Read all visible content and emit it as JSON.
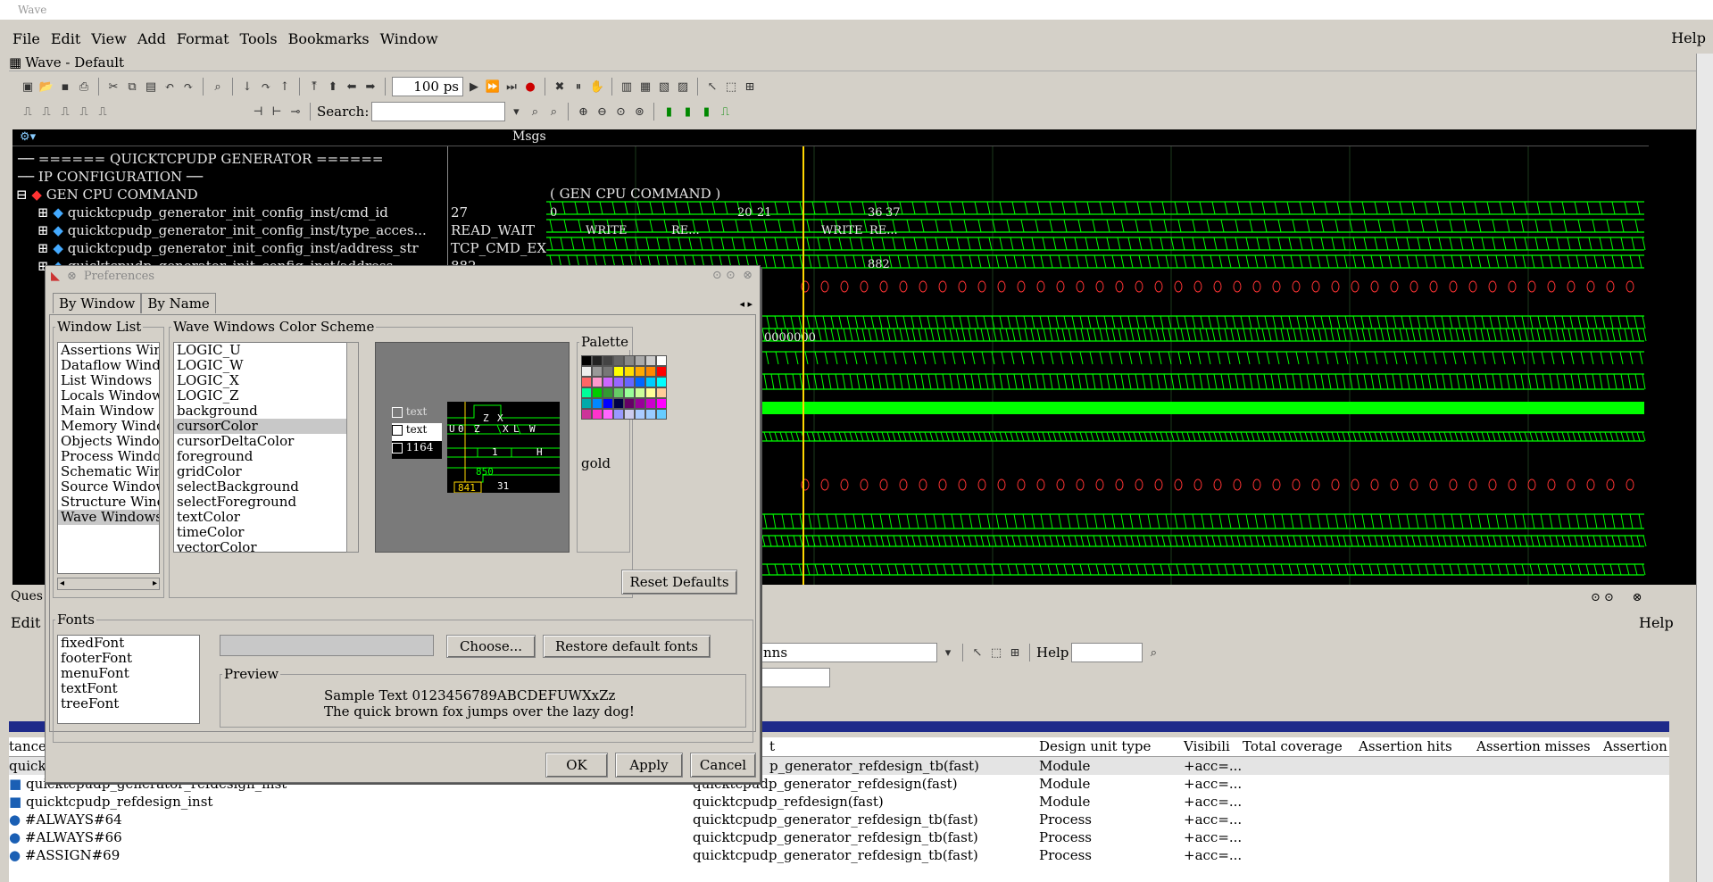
{
  "window": {
    "title": "Wave",
    "subtitle": "Wave - Default",
    "help": "Help"
  },
  "menus": [
    "File",
    "Edit",
    "View",
    "Add",
    "Format",
    "Tools",
    "Bookmarks",
    "Window"
  ],
  "toolbar": {
    "zoom_value": "100 ps",
    "search_label": "Search:"
  },
  "wave": {
    "msgs_label": "Msgs",
    "rows": [
      {
        "name": "====== QUICKTCPUDP GENERATOR ======",
        "value": ""
      },
      {
        "name": "IP CONFIGURATION",
        "value": ""
      },
      {
        "name": "GEN CPU COMMAND",
        "value": ""
      },
      {
        "name": "quicktcpudp_generator_init_config_inst/cmd_id",
        "value": "27"
      },
      {
        "name": "quicktcpudp_generator_init_config_inst/type_acces...",
        "value": "READ_WAIT"
      },
      {
        "name": "quicktcpudp_generator_init_config_inst/address_str",
        "value": "TCP_CMD_EX..."
      },
      {
        "name": "quicktcpudp_generator_init_config_inst/address",
        "value": "882"
      }
    ],
    "group_label": "( GEN CPU COMMAND )",
    "bus_values": [
      "0",
      "20",
      "21",
      "36",
      "37",
      "WRITE",
      "RE...",
      "WRITE",
      "RE...",
      "882",
      "0000000"
    ]
  },
  "prefs": {
    "title": "Preferences",
    "tabs": [
      "By Window",
      "By Name"
    ],
    "window_list_label": "Window List",
    "window_list": [
      "Assertions Windo",
      "Dataflow Windows",
      "List Windows",
      "Locals Window",
      "Main Window",
      "Memory Windows",
      "Objects Window",
      "Process Window",
      "Schematic Window",
      "Source Windows",
      "Structure Window",
      "Wave Windows"
    ],
    "scheme_label": "Wave Windows Color Scheme",
    "scheme_items": [
      "LOGIC_U",
      "LOGIC_W",
      "LOGIC_X",
      "LOGIC_Z",
      "background",
      "cursorColor",
      "cursorDeltaColor",
      "foreground",
      "gridColor",
      "selectBackground",
      "selectForeground",
      "textColor",
      "timeColor",
      "vectorColor"
    ],
    "preview_labels": [
      "text",
      "text",
      "1164"
    ],
    "preview_nums": [
      "850",
      "841",
      "31"
    ],
    "preview_letters": [
      "U",
      "0",
      "Z",
      "X",
      "L",
      "H",
      "1",
      "Z",
      "X",
      "W"
    ],
    "palette_label": "Palette",
    "palette_selected": "gold",
    "reset_defaults": "Reset Defaults",
    "fonts_label": "Fonts",
    "fonts": [
      "fixedFont",
      "footerFont",
      "menuFont",
      "textFont",
      "treeFont"
    ],
    "choose": "Choose...",
    "restore_fonts": "Restore default fonts",
    "preview_label": "Preview",
    "preview_line1": "Sample Text 0123456789ABCDEFUWXxZz",
    "preview_line2": "The quick brown fox jumps over the lazy dog!",
    "ok": "OK",
    "apply": "Apply",
    "cancel": "Cancel"
  },
  "lower": {
    "edit": "Edit",
    "help": "Help",
    "help_field": "Help",
    "ques": "Ques",
    "ns_text": "nns",
    "headers": [
      "Design unit type",
      "Visibili",
      "Total coverage",
      "Assertion hits",
      "Assertion misses",
      "Assertion"
    ],
    "left_hdr": "tance",
    "col2_hdr": "t",
    "rows": [
      {
        "inst": "quick",
        "design": "p_generator_refdesign_tb(fast)",
        "type": "Module",
        "vis": "+acc=..."
      },
      {
        "inst": "quicktcpudp_generator_refdesign_inst",
        "design": "quicktcpudp_generator_refdesign(fast)",
        "type": "Module",
        "vis": "+acc=..."
      },
      {
        "inst": "quicktcpudp_refdesign_inst",
        "design": "quicktcpudp_refdesign(fast)",
        "type": "Module",
        "vis": "+acc=..."
      },
      {
        "inst": "#ALWAYS#64",
        "design": "quicktcpudp_generator_refdesign_tb(fast)",
        "type": "Process",
        "vis": "+acc=..."
      },
      {
        "inst": "#ALWAYS#66",
        "design": "quicktcpudp_generator_refdesign_tb(fast)",
        "type": "Process",
        "vis": "+acc=..."
      },
      {
        "inst": "#ASSIGN#69",
        "design": "quicktcpudp_generator_refdesign_tb(fast)",
        "type": "Process",
        "vis": "+acc=..."
      }
    ]
  },
  "colors": {
    "wave_green": "#00ff00",
    "cursor": "#ffd700",
    "bg": "#000000",
    "red": "#ff0000"
  }
}
